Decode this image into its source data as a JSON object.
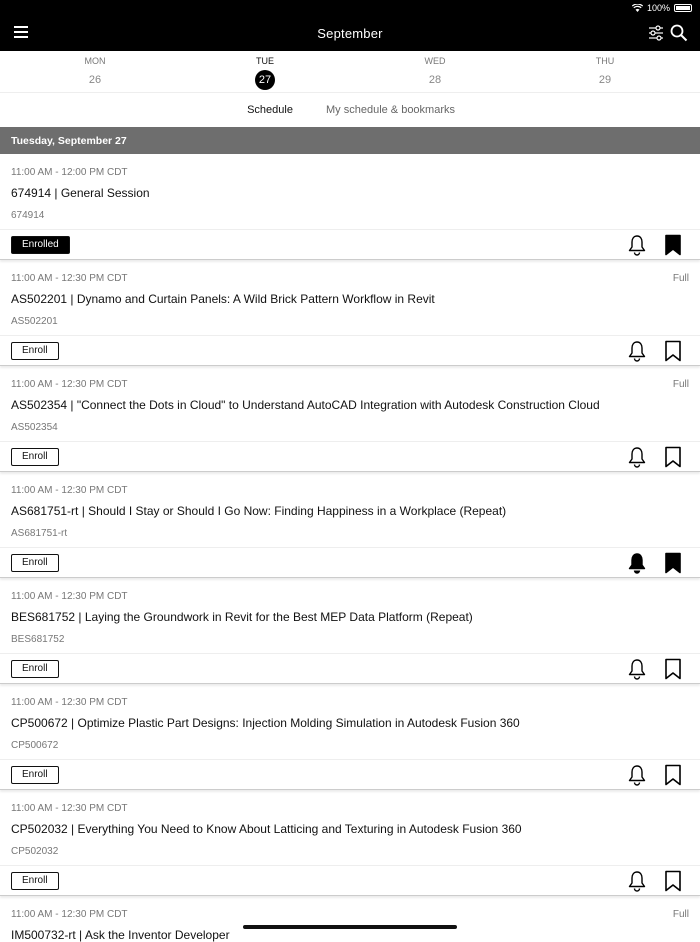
{
  "status": {
    "battery": "100%"
  },
  "header": {
    "title": "September"
  },
  "days": [
    {
      "dow": "MON",
      "num": "26",
      "active": false
    },
    {
      "dow": "TUE",
      "num": "27",
      "active": true
    },
    {
      "dow": "WED",
      "num": "28",
      "active": false
    },
    {
      "dow": "THU",
      "num": "29",
      "active": false
    }
  ],
  "tabs": {
    "schedule": "Schedule",
    "mine": "My schedule & bookmarks"
  },
  "section": {
    "date": "Tuesday, September 27"
  },
  "sessions": [
    {
      "time": "11:00 AM - 12:00 PM CDT",
      "full": "",
      "title": "674914 | General Session",
      "code": "674914",
      "button": "Enrolled",
      "enrolled": true,
      "bell_filled": false,
      "bookmark_filled": true
    },
    {
      "time": "11:00 AM - 12:30 PM CDT",
      "full": "Full",
      "title": "AS502201 | Dynamo and Curtain Panels: A Wild Brick Pattern Workflow in Revit",
      "code": "AS502201",
      "button": "Enroll",
      "enrolled": false,
      "bell_filled": false,
      "bookmark_filled": false
    },
    {
      "time": "11:00 AM - 12:30 PM CDT",
      "full": "Full",
      "title": "AS502354 | \"Connect the Dots in Cloud\" to Understand AutoCAD Integration with Autodesk Construction Cloud",
      "code": "AS502354",
      "button": "Enroll",
      "enrolled": false,
      "bell_filled": false,
      "bookmark_filled": false
    },
    {
      "time": "11:00 AM - 12:30 PM CDT",
      "full": "",
      "title": "AS681751-rt | Should I Stay or Should I Go Now: Finding Happiness in a Workplace (Repeat)",
      "code": "AS681751-rt",
      "button": "Enroll",
      "enrolled": false,
      "bell_filled": true,
      "bookmark_filled": true
    },
    {
      "time": "11:00 AM - 12:30 PM CDT",
      "full": "",
      "title": "BES681752 | Laying the Groundwork in Revit for the Best MEP Data Platform (Repeat)",
      "code": "BES681752",
      "button": "Enroll",
      "enrolled": false,
      "bell_filled": false,
      "bookmark_filled": false
    },
    {
      "time": "11:00 AM - 12:30 PM CDT",
      "full": "",
      "title": "CP500672 | Optimize Plastic Part Designs: Injection Molding Simulation in Autodesk Fusion 360",
      "code": "CP500672",
      "button": "Enroll",
      "enrolled": false,
      "bell_filled": false,
      "bookmark_filled": false
    },
    {
      "time": "11:00 AM - 12:30 PM CDT",
      "full": "",
      "title": "CP502032 | Everything You Need to Know About Latticing and Texturing in Autodesk Fusion 360",
      "code": "CP502032",
      "button": "Enroll",
      "enrolled": false,
      "bell_filled": false,
      "bookmark_filled": false
    }
  ],
  "last": {
    "time": "11:00 AM - 12:30 PM CDT",
    "full": "Full",
    "title": "IM500732-rt | Ask the Inventor Developer"
  }
}
